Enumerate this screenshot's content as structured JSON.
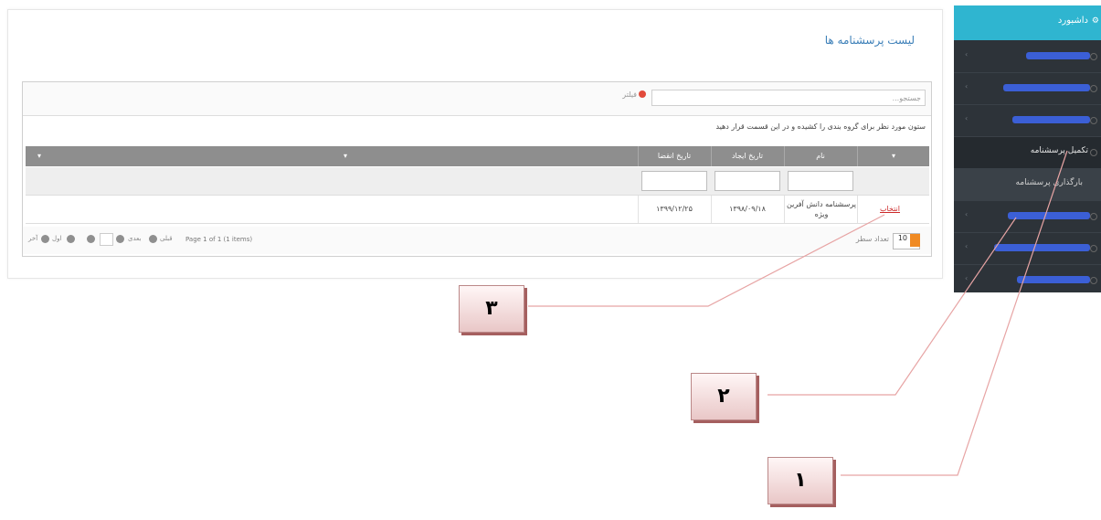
{
  "page": {
    "title": "لیست پرسشنامه ها"
  },
  "search": {
    "placeholder": "جستجو...",
    "filter_label": "فیلتر"
  },
  "grid": {
    "group_hint": "ستون مورد نظر برای گروه بندی را کشیده و در این قسمت قرار دهید",
    "columns": [
      "نام",
      "تاریخ ایجاد",
      "تاریخ انقضا"
    ],
    "rows": [
      {
        "name": "پرسشنامه دانش آفرین ویژه",
        "created": "۱۳۹۸/۰۹/۱۸",
        "expires": "۱۳۹۹/۱۲/۲۵",
        "action": "انتخاب"
      }
    ],
    "pager": {
      "info": "Page 1 of 1 (1 items)",
      "page_size": "10",
      "page_size_label": "تعداد سطر",
      "first": "اول",
      "prev": "قبلی",
      "next": "بعدی",
      "last": "آخر"
    }
  },
  "sidebar": {
    "dashboard": "داشبورد",
    "items": [
      {
        "label": "",
        "blurred": true
      },
      {
        "label": "",
        "blurred": true
      },
      {
        "label": "",
        "blurred": true
      },
      {
        "label": "تکمیل پرسشنامه",
        "blurred": false,
        "active": true
      },
      {
        "label": "بارگذاری پرسشنامه",
        "blurred": false
      },
      {
        "label": "",
        "blurred": true
      },
      {
        "label": "",
        "blurred": true
      },
      {
        "label": "",
        "blurred": true
      }
    ]
  },
  "callouts": [
    "۱",
    "۲",
    "۳"
  ],
  "colors": {
    "sidebar_bg": "#2d3339",
    "dashboard_bg": "#2fb5d0",
    "header_bg": "#8e8e8e",
    "link": "#cc2a2a",
    "annotation_line": "#e7a4a4"
  }
}
